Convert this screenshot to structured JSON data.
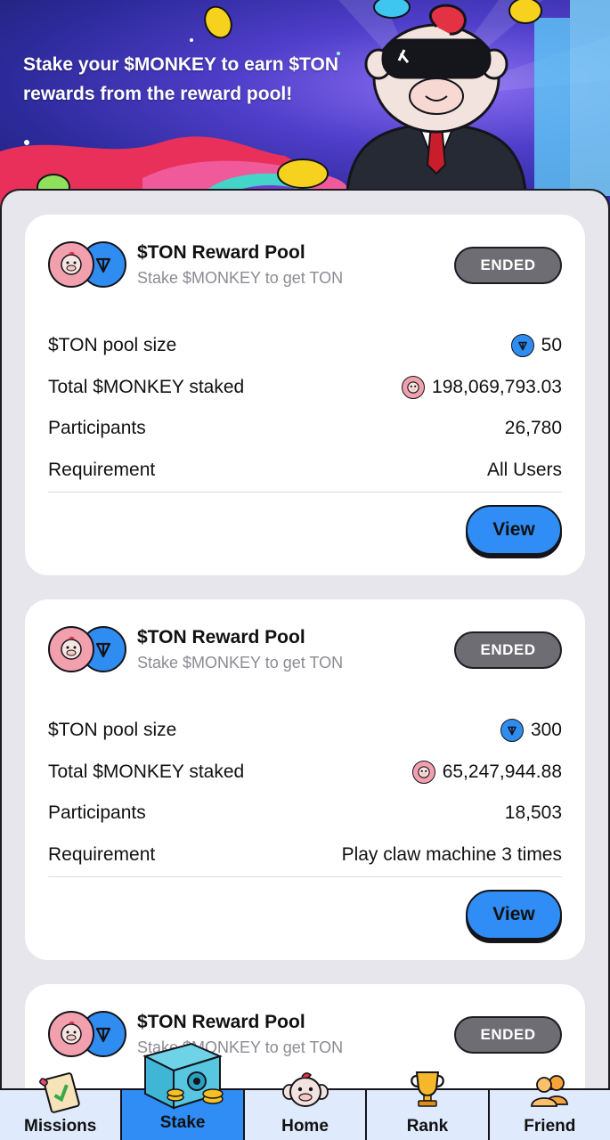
{
  "hero": {
    "text_line1": "Stake your $MONKEY to earn $TON",
    "text_line2": "rewards from the reward pool!"
  },
  "pools": [
    {
      "title": "$TON Reward Pool",
      "subtitle": "Stake $MONKEY to get TON",
      "status": "ENDED",
      "rows": [
        {
          "label": "$TON pool size",
          "value": "50",
          "icon": "ton-coin-icon"
        },
        {
          "label": "Total $MONKEY staked",
          "value": "198,069,793.03",
          "icon": "monkey-coin-icon"
        },
        {
          "label": "Participants",
          "value": "26,780"
        },
        {
          "label": "Requirement",
          "value": "All Users"
        }
      ],
      "button": "View"
    },
    {
      "title": "$TON Reward Pool",
      "subtitle": "Stake $MONKEY to get TON",
      "status": "ENDED",
      "rows": [
        {
          "label": "$TON pool size",
          "value": "300",
          "icon": "ton-coin-icon"
        },
        {
          "label": "Total $MONKEY staked",
          "value": "65,247,944.88",
          "icon": "monkey-coin-icon"
        },
        {
          "label": "Participants",
          "value": "18,503"
        },
        {
          "label": "Requirement",
          "value": "Play claw machine 3 times"
        }
      ],
      "button": "View"
    },
    {
      "title": "$TON Reward Pool",
      "subtitle": "Stake $MONKEY to get TON",
      "status": "ENDED"
    }
  ],
  "nav": {
    "items": [
      {
        "label": "Missions",
        "icon": "clipboard-check-icon"
      },
      {
        "label": "Stake",
        "icon": "safe-vault-icon",
        "active": true
      },
      {
        "label": "Home",
        "icon": "monkey-face-icon"
      },
      {
        "label": "Rank",
        "icon": "trophy-icon"
      },
      {
        "label": "Friend",
        "icon": "friends-icon"
      }
    ]
  },
  "colors": {
    "accent_blue": "#2f8df5",
    "ended_pill": "#6d6d73",
    "monkey_pink": "#f2a0ae"
  }
}
